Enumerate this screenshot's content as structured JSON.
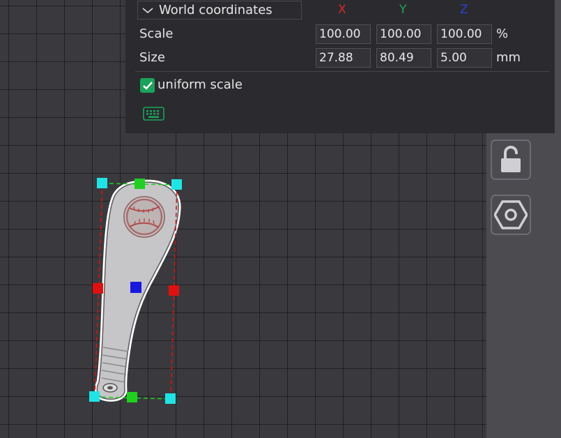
{
  "panel": {
    "coordinate_mode": "World coordinates",
    "axes": {
      "x": "X",
      "y": "Y",
      "z": "Z"
    },
    "axis_colors": {
      "x": "#d62828",
      "y": "#1aa35a",
      "z": "#2a3fd6"
    },
    "scale": {
      "label": "Scale",
      "x": "100.00",
      "y": "100.00",
      "z": "100.00",
      "unit": "%"
    },
    "size": {
      "label": "Size",
      "x": "27.88",
      "y": "80.49",
      "z": "5.00",
      "unit": "mm"
    },
    "uniform_scale": {
      "label": "uniform scale",
      "checked": true
    },
    "accent_color": "#1aa35a"
  },
  "toolbar": {
    "icons": [
      "unlock-icon",
      "hexagon-nut-icon"
    ]
  },
  "viewport": {
    "object": "baseball-bat-model",
    "handle_colors": {
      "corner": "#1ee5e5",
      "edge_y": "#1fd11f",
      "edge_x": "#e01010",
      "center": "#1818e0"
    }
  }
}
